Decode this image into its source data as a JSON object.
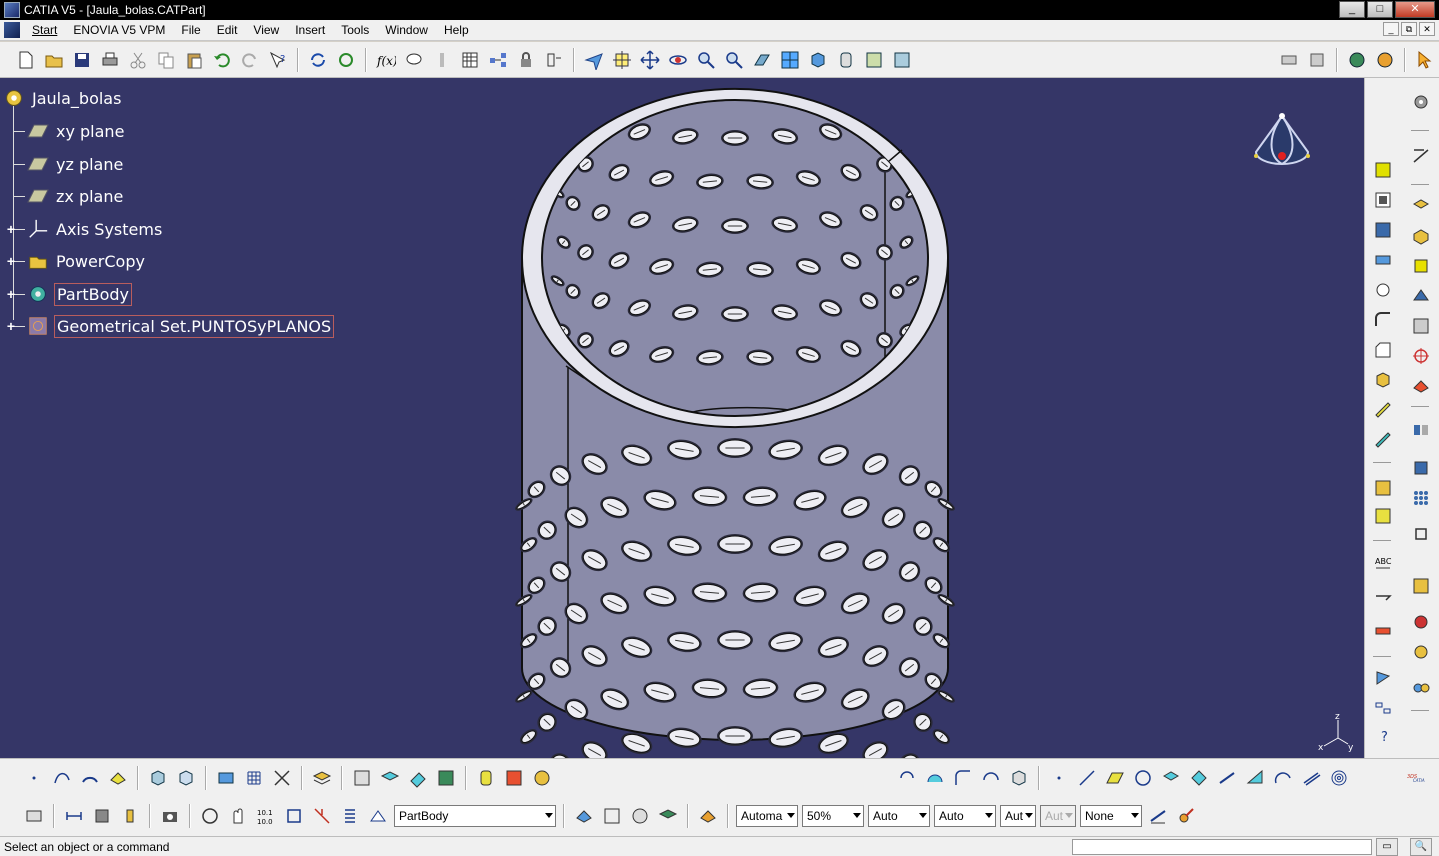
{
  "window": {
    "title": "CATIA V5 - [Jaula_bolas.CATPart]",
    "controls": [
      "_",
      "□",
      "✕"
    ],
    "mdi_controls": [
      "_",
      "⧉",
      "✕"
    ]
  },
  "menu": {
    "items": [
      "Start",
      "ENOVIA V5 VPM",
      "File",
      "Edit",
      "View",
      "Insert",
      "Tools",
      "Window",
      "Help"
    ]
  },
  "spec_tree": {
    "root": "Jaula_bolas",
    "nodes": [
      {
        "label": "xy plane",
        "icon": "plane-icon",
        "expandable": false
      },
      {
        "label": "yz plane",
        "icon": "plane-icon",
        "expandable": false
      },
      {
        "label": "zx plane",
        "icon": "plane-icon",
        "expandable": false
      },
      {
        "label": "Axis Systems",
        "icon": "axis-system-icon",
        "expandable": true
      },
      {
        "label": "PowerCopy",
        "icon": "powercopy-icon",
        "expandable": true
      },
      {
        "label": "PartBody",
        "icon": "partbody-icon",
        "expandable": true
      },
      {
        "label": "Geometrical Set.PUNTOSyPLANOS",
        "icon": "geometrical-set-icon",
        "expandable": true
      }
    ]
  },
  "toolbar_bottom": {
    "current_body": "PartBody",
    "graphic_props": {
      "color": "Automa",
      "transparency": "50%",
      "line_thickness": "Auto",
      "line_type": "Auto",
      "point_type": "Aut",
      "layer_disabled": "Aut",
      "layer": "None"
    }
  },
  "status": {
    "message": "Select an object or a command"
  },
  "colors": {
    "viewport_bg": "#353667",
    "part_fill": "#8e8fae",
    "part_top": "#e8e8f0"
  }
}
